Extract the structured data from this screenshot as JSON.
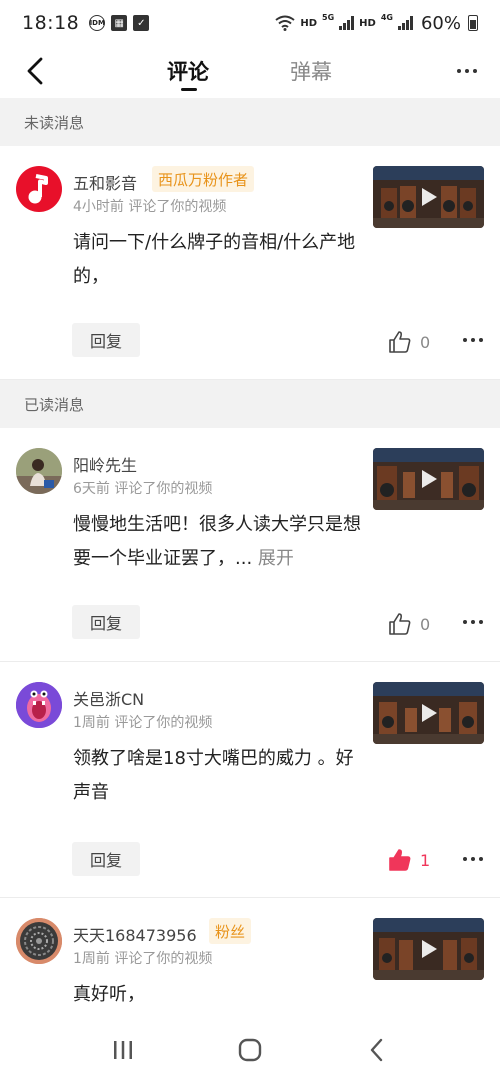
{
  "status": {
    "time": "18:18",
    "battery": "60%",
    "net_labels": [
      "HD",
      "5G",
      "HD",
      "4G"
    ]
  },
  "header": {
    "tabs": [
      {
        "label": "评论",
        "active": true
      },
      {
        "label": "弹幕",
        "active": false
      }
    ]
  },
  "sections": {
    "unread": "未读消息",
    "read": "已读消息"
  },
  "items": [
    {
      "name": "五和影音",
      "badge": "西瓜万粉作者",
      "meta": "4小时前 评论了你的视频",
      "text": "请问一下/什么牌子的音相/什么产地的，",
      "expand": "",
      "reply": "回复",
      "likes": "0",
      "liked": false
    },
    {
      "name": "阳岭先生",
      "badge": "",
      "meta": "6天前 评论了你的视频",
      "text": "慢慢地生活吧！很多人读大学只是想要一个毕业证罢了，...",
      "expand": "展开",
      "reply": "回复",
      "likes": "0",
      "liked": false
    },
    {
      "name": "关邑浙CN",
      "badge": "",
      "meta": "1周前 评论了你的视频",
      "text": "领教了啥是18寸大嘴巴的威力 。好声音",
      "expand": "",
      "reply": "回复",
      "likes": "1",
      "liked": true
    },
    {
      "name": "天天168473956",
      "badge": "粉丝",
      "meta": "1周前 评论了你的视频",
      "text": "真好听，",
      "expand": "",
      "reply": "回复",
      "likes": "",
      "liked": false
    }
  ],
  "colors": {
    "accent_like": "#f0365a",
    "badge_text": "#e8931a",
    "section_bg": "#f2f2f2"
  }
}
